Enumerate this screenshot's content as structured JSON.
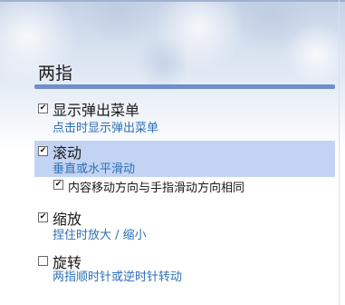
{
  "section": {
    "title": "两指"
  },
  "options": [
    {
      "label": "显示弹出菜单",
      "description": "点击时显示弹出菜单",
      "checked": true
    },
    {
      "label": "滚动",
      "description": "垂直或水平滑动",
      "checked": true,
      "highlighted": true,
      "sub_option": {
        "label": "内容移动方向与手指滑动方向相同",
        "checked": true
      }
    },
    {
      "label": "缩放",
      "description": "捏住时放大 / 缩小",
      "checked": true
    },
    {
      "label": "旋转",
      "description": "两指顺时针或逆时针转动",
      "checked": false
    }
  ],
  "colors": {
    "accent": "#6f8fc8",
    "highlight": "#c3d3f3",
    "description_text": "#2d6fb7"
  }
}
